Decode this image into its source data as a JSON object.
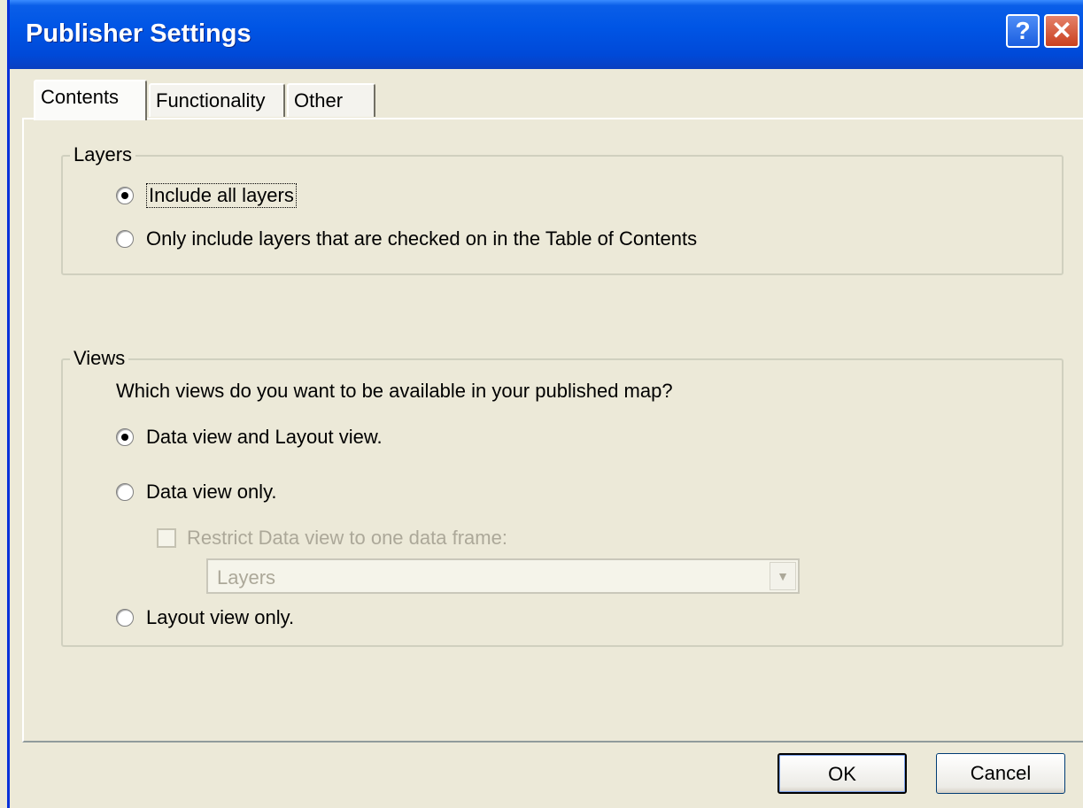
{
  "window": {
    "title": "Publisher Settings"
  },
  "titlebar": {
    "help_glyph": "?",
    "close_glyph": "✕",
    "help_icon": "help-icon",
    "close_icon": "close-icon"
  },
  "tabs": [
    {
      "label": "Contents",
      "active": true
    },
    {
      "label": "Functionality",
      "active": false
    },
    {
      "label": "Other",
      "active": false
    }
  ],
  "layers": {
    "legend": "Layers",
    "options": [
      {
        "label": "Include all layers",
        "checked": true
      },
      {
        "label": "Only include layers that are checked on in the Table of Contents",
        "checked": false
      }
    ]
  },
  "views": {
    "legend": "Views",
    "question": "Which views do you want to be available in your published map?",
    "options": [
      {
        "label": "Data view and Layout view.",
        "checked": true
      },
      {
        "label": "Data view only.",
        "checked": false
      },
      {
        "label": "Layout view only.",
        "checked": false
      }
    ],
    "restrict_checkbox": {
      "label": "Restrict Data view to one data frame:",
      "checked": false,
      "enabled": false
    },
    "data_frame_select": {
      "value": "Layers",
      "enabled": false
    }
  },
  "buttons": {
    "ok": "OK",
    "cancel": "Cancel"
  },
  "colors": {
    "titlebar": "#0055e5",
    "face": "#ece9d8",
    "disabled_text": "#aca899"
  }
}
